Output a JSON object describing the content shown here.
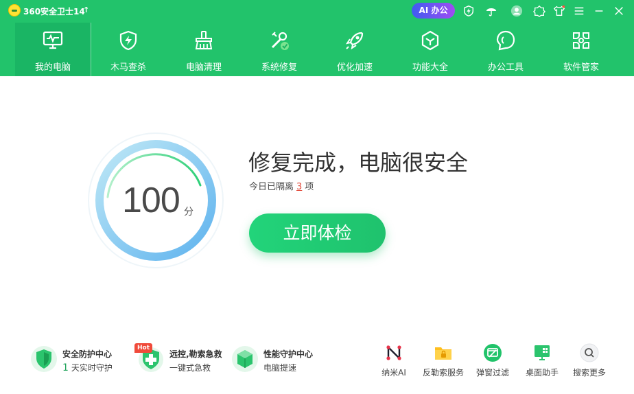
{
  "app": {
    "title": "360安全卫士14"
  },
  "titlebar": {
    "ai_label": "AI 办公"
  },
  "tabs": [
    {
      "label": "我的电脑"
    },
    {
      "label": "木马查杀"
    },
    {
      "label": "电脑清理"
    },
    {
      "label": "系统修复"
    },
    {
      "label": "优化加速"
    },
    {
      "label": "功能大全"
    },
    {
      "label": "办公工具"
    },
    {
      "label": "软件管家"
    }
  ],
  "main": {
    "score": "100",
    "score_unit": "分",
    "headline": "修复完成，电脑很安全",
    "sub_prefix": "今日已隔离",
    "sub_count": "3",
    "sub_suffix": "项",
    "check_button": "立即体检"
  },
  "features": [
    {
      "title": "安全防护中心",
      "sub_num": "1",
      "sub": "天实时守护"
    },
    {
      "title": "远控,勒索急救",
      "sub": "一键式急救",
      "badge": "Hot"
    },
    {
      "title": "性能守护中心",
      "sub": "电脑提速"
    }
  ],
  "tools": [
    {
      "label": "纳米AI"
    },
    {
      "label": "反勒索服务"
    },
    {
      "label": "弹窗过滤"
    },
    {
      "label": "桌面助手"
    },
    {
      "label": "搜索更多"
    }
  ],
  "colors": {
    "brand_green": "#22c36b",
    "active_tab": "#1ab564",
    "accent_red": "#e24a3b"
  }
}
